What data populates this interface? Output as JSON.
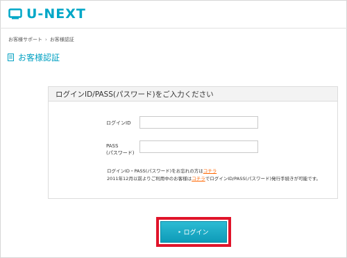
{
  "brand": {
    "name": "U-NEXT",
    "color": "#00a7c7"
  },
  "breadcrumb": {
    "items": [
      "お客様サポート",
      "お客様認証"
    ],
    "separator": "›"
  },
  "page_title": "お客様認証",
  "form": {
    "heading": "ログインID/PASS(パスワード)をご入力ください",
    "login_id_label": "ログインID",
    "login_id_value": "",
    "pass_label_line1": "PASS",
    "pass_label_line2": "(パスワード)",
    "pass_value": "",
    "note_line1_text": "ログインID・PASS(パスワード)をお忘れの方は",
    "note_line1_link": "コチラ",
    "note_line2_text_a": "2011年12月以前よりご利用中のお客様は",
    "note_line2_link": "コチラ",
    "note_line2_text_b": "でログインID/PASS(パスワード)発行手続きが可能です。"
  },
  "login_button": {
    "label": "ログイン",
    "arrow": "▸"
  },
  "colors": {
    "accent": "#00a0c2",
    "link": "#ff6600",
    "highlight": "#e0142a"
  },
  "icons": {
    "logo": "tv-icon",
    "title": "document-icon"
  }
}
